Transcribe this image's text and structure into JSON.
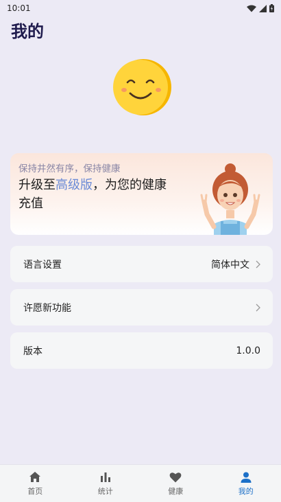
{
  "status": {
    "time": "10:01"
  },
  "page": {
    "title": "我的"
  },
  "promo": {
    "subtitle": "保持井然有序，保持健康",
    "main_prefix": "升级至",
    "main_highlight": "高级版",
    "main_suffix": "，为您的健康充值"
  },
  "settings": {
    "language": {
      "label": "语言设置",
      "value": "简体中文"
    },
    "wish": {
      "label": "许愿新功能"
    },
    "version": {
      "label": "版本",
      "value": "1.0.0"
    }
  },
  "tabs": [
    {
      "label": "首页",
      "icon": "home-icon"
    },
    {
      "label": "统计",
      "icon": "bar-chart-icon"
    },
    {
      "label": "健康",
      "icon": "heart-icon"
    },
    {
      "label": "我的",
      "icon": "person-icon",
      "active": true
    }
  ],
  "colors": {
    "accent": "#1d70c8",
    "title": "#1f1b4d",
    "highlight": "#6a8ad6"
  }
}
